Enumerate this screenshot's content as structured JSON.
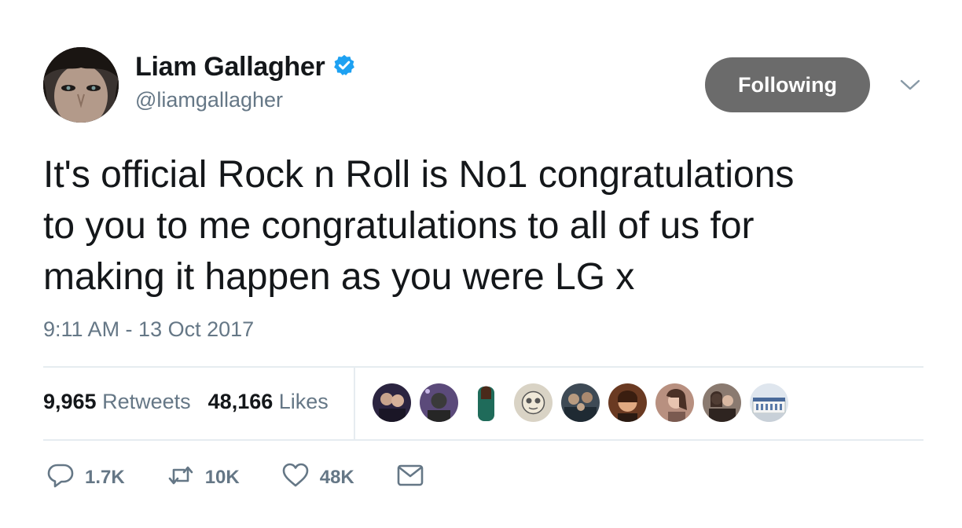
{
  "author": {
    "display_name": "Liam Gallagher",
    "handle": "@liamgallagher",
    "verified": true
  },
  "follow_button": {
    "label": "Following"
  },
  "tweet": {
    "text": "It's official Rock n Roll is No1 congratulations\nto you to me congratulations to all of us for\nmaking it happen as you were LG x",
    "timestamp": "9:11 AM - 13 Oct 2017"
  },
  "stats": {
    "retweets": {
      "count": "9,965",
      "label": "Retweets"
    },
    "likes": {
      "count": "48,166",
      "label": "Likes"
    }
  },
  "actions": {
    "reply_count": "1.7K",
    "retweet_count": "10K",
    "like_count": "48K"
  },
  "colors": {
    "verified": "#1da1f2",
    "following_bg": "#6b6b6b",
    "secondary_text": "#657786",
    "divider": "#e6ecf0"
  },
  "icons": [
    "verified-badge-icon",
    "chevron-down-icon",
    "reply-icon",
    "retweet-icon",
    "heart-icon",
    "envelope-icon"
  ]
}
